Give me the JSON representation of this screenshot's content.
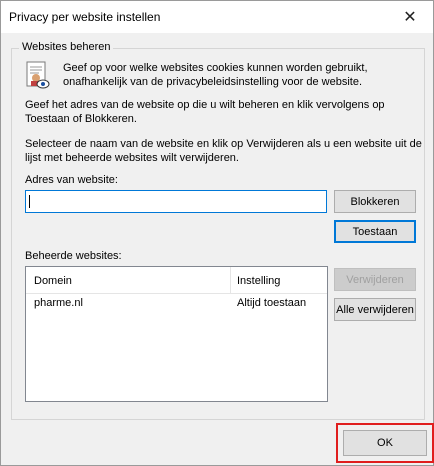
{
  "window": {
    "title": "Privacy per website instellen",
    "close_symbol": "✕"
  },
  "group": {
    "legend": "Websites beheren",
    "description_line1": "Geef op voor welke websites cookies kunnen worden gebruikt,",
    "description_line2": "onafhankelijk van de privacybeleidsinstelling voor de website.",
    "instruction1_line1": "Geef het adres van de website op die u wilt beheren en klik vervolgens op",
    "instruction1_line2": "Toestaan of Blokkeren.",
    "instruction2_line1": "Selecteer de naam van de website en klik op Verwijderen als u een website uit de",
    "instruction2_line2": "lijst met beheerde websites wilt verwijderen."
  },
  "address": {
    "label": "Adres van website:",
    "value": ""
  },
  "buttons": {
    "block": "Blokkeren",
    "allow": "Toestaan",
    "remove": "Verwijderen",
    "remove_all": "Alle verwijderen",
    "ok": "OK"
  },
  "managed": {
    "label": "Beheerde websites:",
    "columns": [
      "Domein",
      "Instelling"
    ],
    "rows": [
      {
        "domain": "pharme.nl",
        "setting": "Altijd toestaan"
      }
    ]
  },
  "icons": {
    "info": "privacy-document-eye-icon",
    "close": "close-icon"
  },
  "colors": {
    "focus_blue": "#0078d7",
    "highlight_red": "#e01e1e"
  }
}
